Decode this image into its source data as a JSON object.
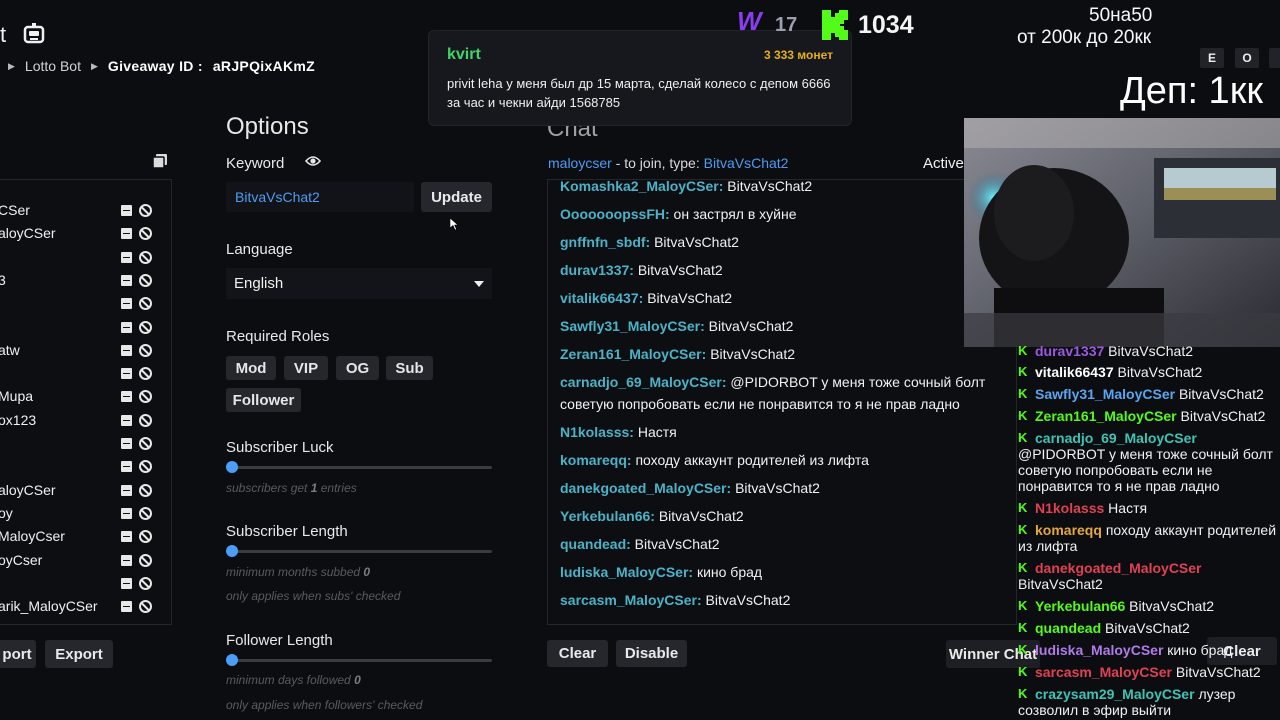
{
  "header": {
    "app_initial": "t",
    "breadcrumb": [
      "Lotto Bot",
      "Giveaway ID :",
      "aRJPQixAKmZ"
    ]
  },
  "users": {
    "names": [
      "CSer",
      "aloyCSer",
      "",
      "3",
      "",
      "",
      "atw",
      "",
      "Mupa",
      "ox123",
      "",
      "",
      "aloyCSer",
      "oy",
      "MaloyCser",
      "oyCser",
      "",
      "arik_MaloyCSer"
    ],
    "buttons": {
      "import": "port",
      "export": "Export"
    }
  },
  "options": {
    "title": "Options",
    "keyword_label": "Keyword",
    "keyword_value": "BitvaVsChat2",
    "update_button": "Update",
    "language_label": "Language",
    "language_value": "English",
    "roles_label": "Required Roles",
    "roles": [
      "Mod",
      "VIP",
      "OG",
      "Sub",
      "Follower"
    ],
    "sub_luck": {
      "label": "Subscriber Luck",
      "hint_pre": "subscribers get",
      "hint_val": "1",
      "hint_post": "entries",
      "value": 0
    },
    "sub_length": {
      "label": "Subscriber Length",
      "hint_pre": "minimum months subbed",
      "hint_val": "0",
      "hint2": "only applies when subs' checked",
      "value": 0
    },
    "follower_length": {
      "label": "Follower Length",
      "hint_pre": "minimum days followed",
      "hint_val": "0",
      "hint2": "only applies when followers' checked",
      "value": 0
    }
  },
  "chat": {
    "title": "Chat",
    "join_user": "maloycser",
    "join_text": "- to join, type:",
    "join_keyword": "BitvaVsChat2",
    "active_label": "Active",
    "messages": [
      {
        "user": "Komashka2_MaloyCSer:",
        "text": "BitvaVsChat2"
      },
      {
        "user": "OoooooopssFH:",
        "text": "он застрял в хуйне"
      },
      {
        "user": "gnffnfn_sbdf:",
        "text": "BitvaVsChat2"
      },
      {
        "user": "durav1337:",
        "text": "BitvaVsChat2"
      },
      {
        "user": "vitalik66437:",
        "text": "BitvaVsChat2"
      },
      {
        "user": "Sawfly31_MaloyCSer:",
        "text": "BitvaVsChat2"
      },
      {
        "user": "Zeran161_MaloyCSer:",
        "text": "BitvaVsChat2"
      },
      {
        "user": "carnadjo_69_MaloyCSer:",
        "text": "@PIDORBOT у меня тоже сочный болт советую попробовать если не понравится то я не прав ладно"
      },
      {
        "user": "N1kolasss:",
        "text": "Настя"
      },
      {
        "user": "komareqq:",
        "text": "походу аккаунт родителей из лифта"
      },
      {
        "user": "danekgoated_MaloyCSer:",
        "text": "BitvaVsChat2"
      },
      {
        "user": "Yerkebulan66:",
        "text": "BitvaVsChat2"
      },
      {
        "user": "quandead:",
        "text": "BitvaVsChat2"
      },
      {
        "user": "ludiska_MaloyCSer:",
        "text": "кино брад"
      },
      {
        "user": "sarcasm_MaloyCSer:",
        "text": "BitvaVsChat2"
      }
    ],
    "clear_button": "Clear",
    "disable_button": "Disable",
    "winner_chat_button": "Winner Chat",
    "clear_right_button": "Clear"
  },
  "donation": {
    "name": "kvirt",
    "amount": "3 333 монет",
    "text": "privit leha у меня был др 15 марта, сделай колесо с депом 6666 за час и чекни айди 1568785"
  },
  "overlay": {
    "w_logo": "W",
    "w_count": "17",
    "kick_count": "1034",
    "line1": "50на50",
    "line2": "от 200к до 20кк",
    "keys": [
      "E",
      "O",
      ""
    ],
    "dep": "Деп: 1кк"
  },
  "kick_chat": [
    {
      "user": "durav1337",
      "color": "#9b59e0",
      "text": "BitvaVsChat2"
    },
    {
      "user": "vitalik66437",
      "color": "#ffffff",
      "text": "BitvaVsChat2"
    },
    {
      "user": "Sawfly31_MaloyCSer",
      "color": "#5aa6f0",
      "text": "BitvaVsChat2"
    },
    {
      "user": "Zeran161_MaloyCSer",
      "color": "#53fc18",
      "text": "BitvaVsChat2"
    },
    {
      "user": "carnadjo_69_MaloyCSer",
      "color": "#3fc3b5",
      "text": "@PIDORBOT у меня тоже сочный болт советую попробовать если не понравится то я не прав ладно"
    },
    {
      "user": "N1kolasss",
      "color": "#e04155",
      "text": "Настя"
    },
    {
      "user": "komareqq",
      "color": "#e3a93b",
      "text": "походу аккаунт родителей из лифта"
    },
    {
      "user": "danekgoated_MaloyCSer",
      "color": "#e04155",
      "text": "BitvaVsChat2"
    },
    {
      "user": "Yerkebulan66",
      "color": "#53fc18",
      "text": "BitvaVsChat2"
    },
    {
      "user": "quandead",
      "color": "#53fc18",
      "text": "BitvaVsChat2"
    },
    {
      "user": "ludiska_MaloyCSer",
      "color": "#b07be8",
      "text": "кино брад"
    },
    {
      "user": "sarcasm_MaloyCSer",
      "color": "#e04155",
      "text": "BitvaVsChat2"
    },
    {
      "user": "crazysam29_MaloyCSer",
      "color": "#3fc3b5",
      "text": "лузер созволил в эфир выйти"
    }
  ]
}
